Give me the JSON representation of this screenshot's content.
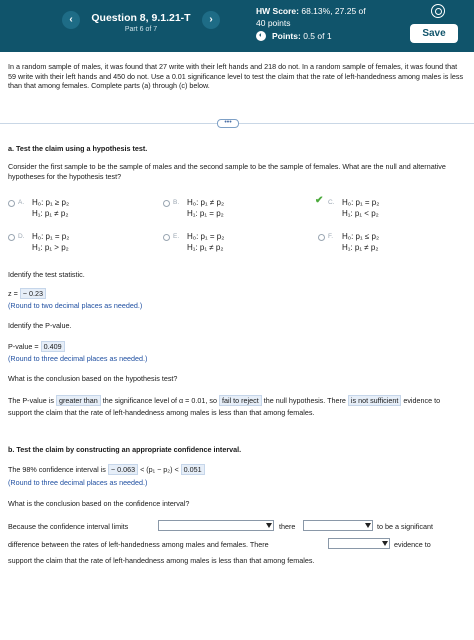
{
  "header": {
    "question_title": "Question 8, 9.1.21-T",
    "part": "Part 6 of 7",
    "hw_score_label": "HW Score:",
    "hw_score_value": "68.13%, 27.25 of",
    "hw_points": "40 points",
    "points_label": "Points:",
    "points_value": "0.5 of 1",
    "save_label": "Save",
    "prev_icon": "chevron-left-icon",
    "next_icon": "chevron-right-icon",
    "settings_icon": "gear-icon",
    "accent_color": "#10546b"
  },
  "problem": {
    "text": "In a random sample of males, it was found that 27 write with their left hands and 218 do not. In a random sample of females, it was found that 59 write with their left hands and 450 do not. Use a 0.01 significance level to test the claim that the rate of left-handedness among males is less than that among females. Complete parts (a) through (c) below."
  },
  "part_a": {
    "heading": "a. Test the claim using a hypothesis test.",
    "prompt": "Consider the first sample to be the sample of males and the second sample to be the sample of females. What are the null and alternative hypotheses for the hypothesis test?",
    "options": [
      {
        "letter": "A.",
        "h0": "H₀: p₁ ≥ p₂",
        "h1": "H₁: p₁ ≠ p₂",
        "selected": false
      },
      {
        "letter": "B.",
        "h0": "H₀: p₁ ≠ p₂",
        "h1": "H₁: p₁ = p₂",
        "selected": false
      },
      {
        "letter": "C.",
        "h0": "H₀: p₁ = p₂",
        "h1": "H₁: p₁ < p₂",
        "selected": true
      },
      {
        "letter": "D.",
        "h0": "H₀: p₁ = p₂",
        "h1": "H₁: p₁ > p₂",
        "selected": false
      },
      {
        "letter": "E.",
        "h0": "H₀: p₁ = p₂",
        "h1": "H₁: p₁ ≠ p₂",
        "selected": false
      },
      {
        "letter": "F.",
        "h0": "H₀: p₁ ≤ p₂",
        "h1": "H₁: p₁ ≠ p₂",
        "selected": false
      }
    ],
    "test_stat_prompt": "Identify the test statistic.",
    "z_label": "z =",
    "z_value": "− 0.23",
    "z_round": "(Round to two decimal places as needed.)",
    "pvalue_prompt": "Identify the P-value.",
    "pvalue_label": "P-value =",
    "pvalue_value": "0.409",
    "pvalue_round": "(Round to three decimal places as needed.)",
    "conclusion_prompt": "What is the conclusion based on the hypothesis test?",
    "conclusion_1": "The P-value is",
    "conclusion_choice_1": "greater than",
    "conclusion_2": "the significance level of α = 0.01, so",
    "conclusion_choice_2": "fail to reject",
    "conclusion_3": "the null hypothesis. There",
    "conclusion_choice_3": "is not sufficient",
    "conclusion_4": "evidence to support the claim that the rate of left-handedness among males is less than that among females."
  },
  "part_b": {
    "heading": "b. Test the claim by constructing an appropriate confidence interval.",
    "ci_label": "The 98% confidence interval is",
    "ci_lower": "− 0.063",
    "ci_middle": "< (p₁ − p₂) <",
    "ci_upper": "0.051",
    "ci_round": "(Round to three decimal places as needed.)",
    "ci_prompt": "What is the conclusion based on the confidence interval?",
    "sentence_1": "Because the confidence interval limits",
    "sentence_2": "there",
    "sentence_3": "to be a significant",
    "sentence_4": "difference between the rates of left-handedness among males and females. There",
    "sentence_5": "evidence to",
    "sentence_6": "support the claim that the rate of left-handedness among males is less than that among females."
  }
}
